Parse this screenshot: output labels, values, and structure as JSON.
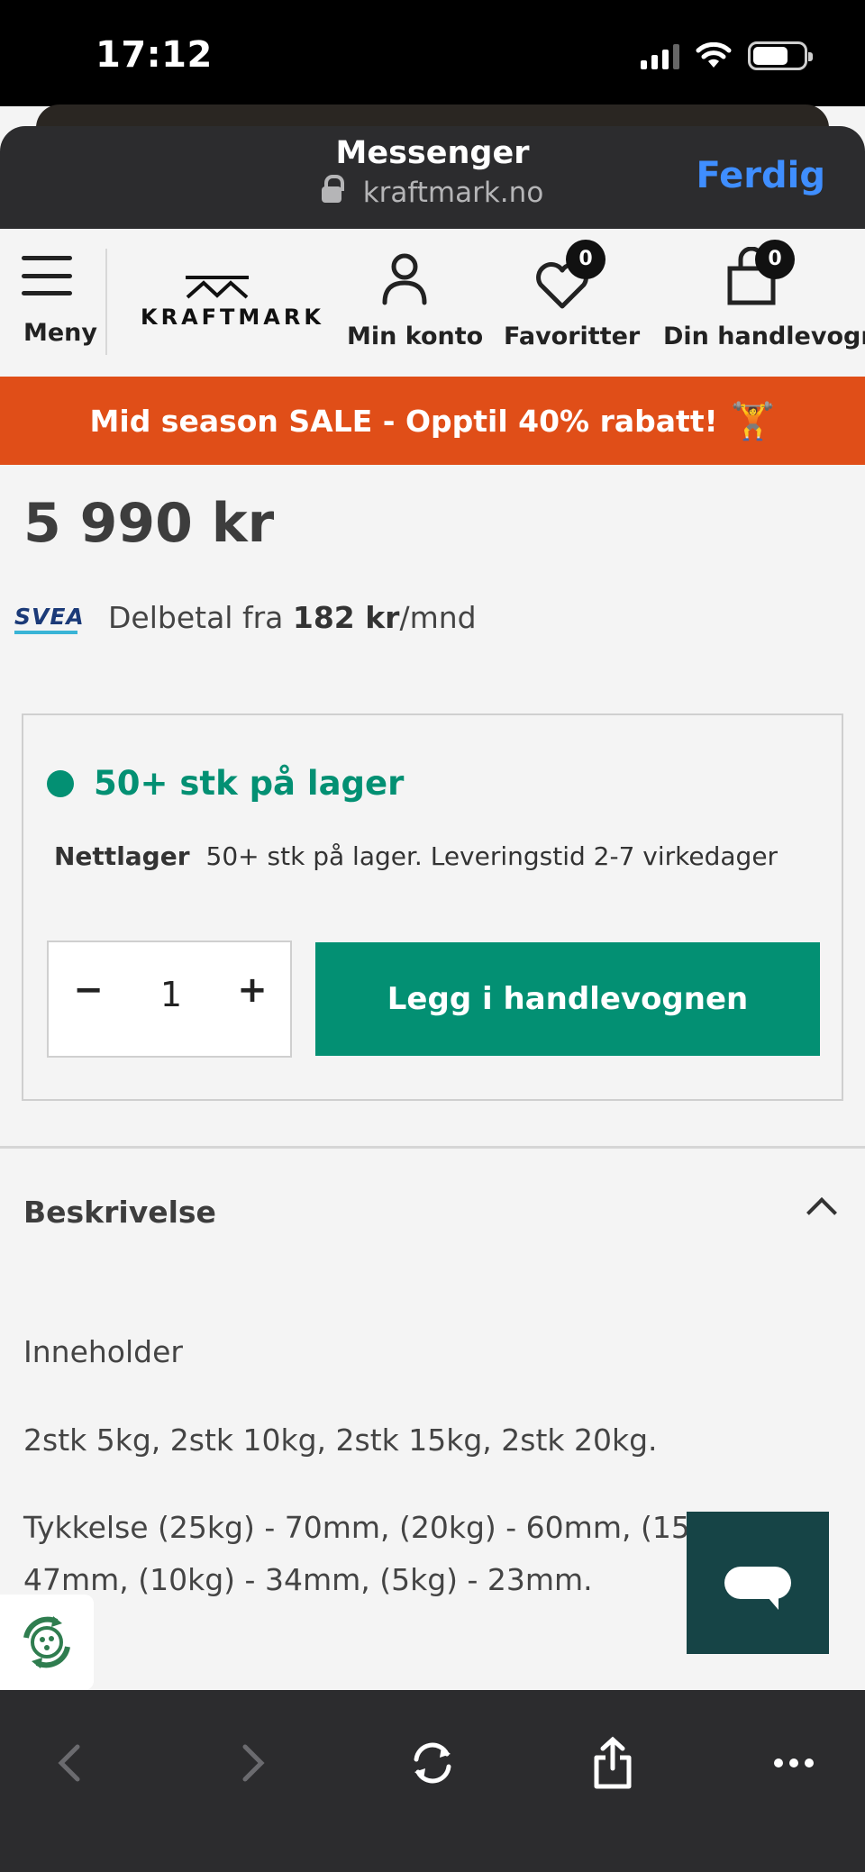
{
  "status_bar": {
    "time": "17:12"
  },
  "browser": {
    "title": "Messenger",
    "url": "kraftmark.no",
    "done_label": "Ferdig"
  },
  "site_nav": {
    "menu_label": "Meny",
    "logo_text": "KRAFTMARK",
    "account_label": "Min konto",
    "favorites_label": "Favoritter",
    "favorites_count": "0",
    "cart_label": "Din handlevogn",
    "cart_count": "0"
  },
  "sale_banner": {
    "text": "Mid season SALE - Opptil 40% rabatt!",
    "emoji": "🏋️"
  },
  "product": {
    "price": "5 990 kr",
    "financing": {
      "provider": "SVEA",
      "prefix": "Delbetal fra",
      "amount": "182 kr",
      "suffix": "/mnd"
    },
    "stock": {
      "status": "50+ stk på lager",
      "location_label": "Nettlager",
      "location_text": "50+ stk på lager. Leveringstid 2-7 virkedager"
    },
    "quantity": "1",
    "decrement_label": "−",
    "increment_label": "+",
    "add_to_cart_label": "Legg i handlevognen"
  },
  "description": {
    "heading": "Beskrivelse",
    "paragraphs": [
      "Inneholder",
      "2stk 5kg, 2stk 10kg, 2stk 15kg, 2stk 20kg.",
      "Tykkelse (25kg) - 70mm, (20kg) - 60mm, (15kg) - 47mm, (10kg) - 34mm, (5kg) - 23mm."
    ]
  },
  "colors": {
    "accent_green": "#039073",
    "sale_orange": "#e04e18",
    "ios_blue": "#3f8eff",
    "chat_teal": "#164446"
  },
  "icons": [
    "lock-icon",
    "hamburger-icon",
    "user-icon",
    "heart-icon",
    "cart-bag-icon",
    "chevron-up-icon",
    "chat-icon",
    "eco-recycle-icon",
    "back-icon",
    "forward-icon",
    "refresh-icon",
    "share-icon",
    "more-icon"
  ]
}
